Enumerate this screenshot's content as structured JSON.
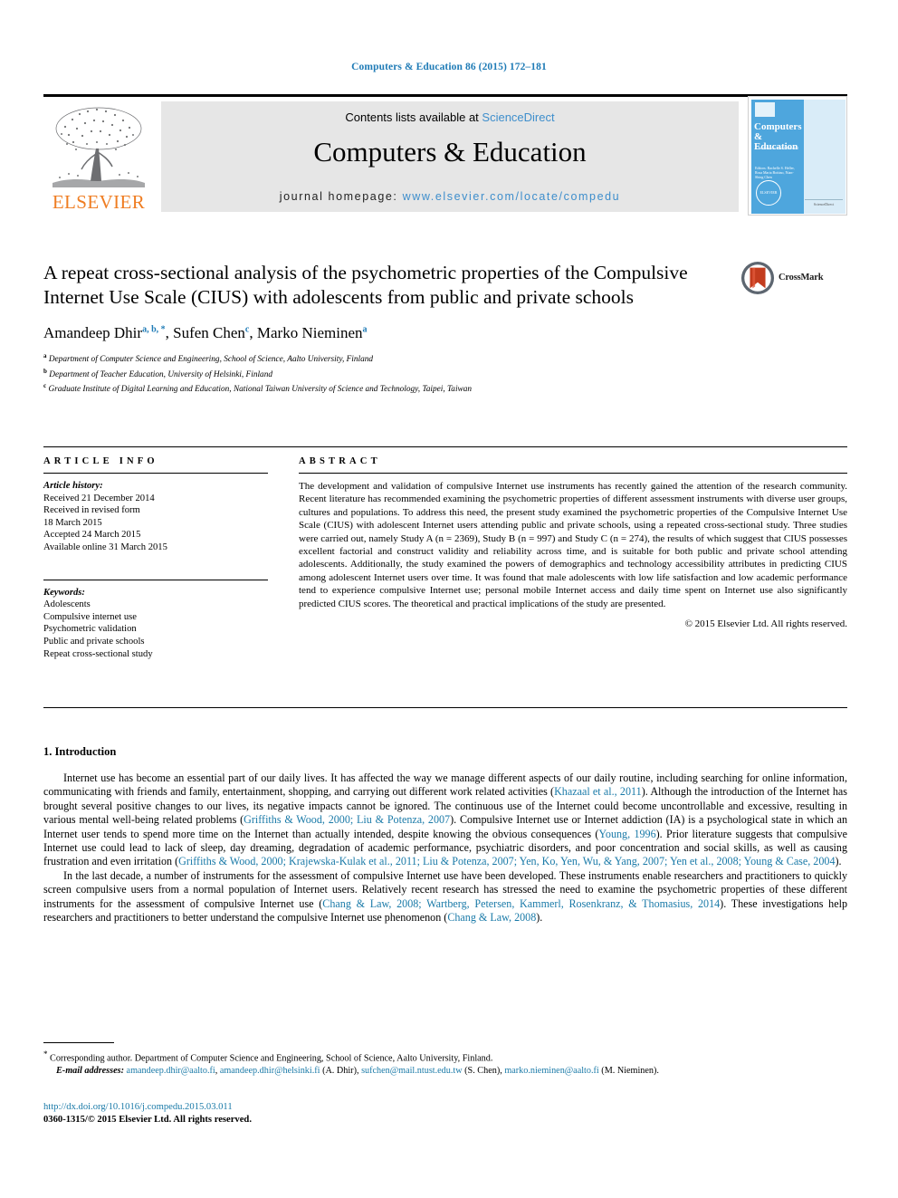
{
  "running_head": "Computers & Education 86 (2015) 172–181",
  "masthead": {
    "contents_prefix": "Contents lists available at ",
    "sciencedirect": "ScienceDirect",
    "journal_name": "Computers & Education",
    "homepage_prefix": "journal homepage: ",
    "homepage_url": "www.elsevier.com/locate/compedu",
    "publisher_wordmark": "ELSEVIER",
    "cover": {
      "title": "Computers & Education",
      "subtitle": "An International Journal",
      "editors": "Editors: Rachelle S. Heller, Rosa Maria Bottino, Nian-Shing Chen",
      "seal": "ELSEVIER",
      "footer": "ScienceDirect"
    }
  },
  "article": {
    "title": "A repeat cross-sectional analysis of the psychometric properties of the Compulsive Internet Use Scale (CIUS) with adolescents from public and private schools",
    "crossmark_label": "CrossMark",
    "authors": [
      {
        "name": "Amandeep Dhir",
        "marks": "a, b, *"
      },
      {
        "name": "Sufen Chen",
        "marks": "c"
      },
      {
        "name": "Marko Nieminen",
        "marks": "a"
      }
    ],
    "affiliations": [
      {
        "mark": "a",
        "text": "Department of Computer Science and Engineering, School of Science, Aalto University, Finland"
      },
      {
        "mark": "b",
        "text": "Department of Teacher Education, University of Helsinki, Finland"
      },
      {
        "mark": "c",
        "text": "Graduate Institute of Digital Learning and Education, National Taiwan University of Science and Technology, Taipei, Taiwan"
      }
    ]
  },
  "article_info": {
    "heading": "ARTICLE INFO",
    "history_label": "Article history:",
    "history_lines": [
      "Received 21 December 2014",
      "Received in revised form",
      "18 March 2015",
      "Accepted 24 March 2015",
      "Available online 31 March 2015"
    ],
    "keywords_label": "Keywords:",
    "keywords": [
      "Adolescents",
      "Compulsive internet use",
      "Psychometric validation",
      "Public and private schools",
      "Repeat cross-sectional study"
    ]
  },
  "abstract": {
    "heading": "ABSTRACT",
    "text": "The development and validation of compulsive Internet use instruments has recently gained the attention of the research community. Recent literature has recommended examining the psychometric properties of different assessment instruments with diverse user groups, cultures and populations. To address this need, the present study examined the psychometric properties of the Compulsive Internet Use Scale (CIUS) with adolescent Internet users attending public and private schools, using a repeated cross-sectional study. Three studies were carried out, namely Study A (n = 2369), Study B (n = 997) and Study C (n = 274), the results of which suggest that CIUS possesses excellent factorial and construct validity and reliability across time, and is suitable for both public and private school attending adolescents. Additionally, the study examined the powers of demographics and technology accessibility attributes in predicting CIUS among adolescent Internet users over time. It was found that male adolescents with low life satisfaction and low academic performance tend to experience compulsive Internet use; personal mobile Internet access and daily time spent on Internet use also significantly predicted CIUS scores. The theoretical and practical implications of the study are presented.",
    "copyright": "© 2015 Elsevier Ltd. All rights reserved."
  },
  "introduction": {
    "section_number_title": "1. Introduction",
    "paragraph1": {
      "part1": "Internet use has become an essential part of our daily lives. It has affected the way we manage different aspects of our daily routine, including searching for online information, communicating with friends and family, entertainment, shopping, and carrying out different work related activities (",
      "cite1": "Khazaal et al., 2011",
      "part2": "). Although the introduction of the Internet has brought several positive changes to our lives, its negative impacts cannot be ignored. The continuous use of the Internet could become uncontrollable and excessive, resulting in various mental well-being related problems (",
      "cite2": "Griffiths & Wood, 2000; Liu & Potenza, 2007",
      "part3": "). Compulsive Internet use or Internet addiction (IA) is a psychological state in which an Internet user tends to spend more time on the Internet than actually intended, despite knowing the obvious consequences (",
      "cite3": "Young, 1996",
      "part4": "). Prior literature suggests that compulsive Internet use could lead to lack of sleep, day dreaming, degradation of academic performance, psychiatric disorders, and poor concentration and social skills, as well as causing frustration and even irritation (",
      "cite4": "Griffiths & Wood, 2000; Krajewska-Kulak et al., 2011; Liu & Potenza, 2007; Yen, Ko, Yen, Wu, & Yang, 2007; Yen et al., 2008; Young & Case, 2004",
      "part5": ")."
    },
    "paragraph2": {
      "part1": "In the last decade, a number of instruments for the assessment of compulsive Internet use have been developed. These instruments enable researchers and practitioners to quickly screen compulsive users from a normal population of Internet users. Relatively recent research has stressed the need to examine the psychometric properties of these different instruments for the assessment of compulsive Internet use (",
      "cite1": "Chang & Law, 2008; Wartberg, Petersen, Kammerl, Rosenkranz, & Thomasius, 2014",
      "part2": "). These investigations help researchers and practitioners to better understand the compulsive Internet use phenomenon (",
      "cite2": "Chang & Law, 2008",
      "part3": ")."
    }
  },
  "footnotes": {
    "corresponding": "Corresponding author. Department of Computer Science and Engineering, School of Science, Aalto University, Finland.",
    "email_label": "E-mail addresses:",
    "emails": [
      {
        "address": "amandeep.dhir@aalto.fi",
        "sep": ", "
      },
      {
        "address": "amandeep.dhir@helsinki.fi",
        "owner": " (A. Dhir), "
      },
      {
        "address": "sufchen@mail.ntust.edu.tw",
        "owner": " (S. Chen), "
      },
      {
        "address": "marko.nieminen@aalto.fi",
        "owner": " (M. Nieminen)."
      }
    ]
  },
  "footer": {
    "doi": "http://dx.doi.org/10.1016/j.compedu.2015.03.011",
    "issn": "0360-1315/© 2015 Elsevier Ltd. All rights reserved."
  },
  "colors": {
    "link_blue": "#1a7aa8",
    "header_blue": "#3e8ecc",
    "elsevier_orange": "#ef7d22",
    "cover_blue": "#4ea6dd",
    "band_gray": "#e6e6e6"
  }
}
